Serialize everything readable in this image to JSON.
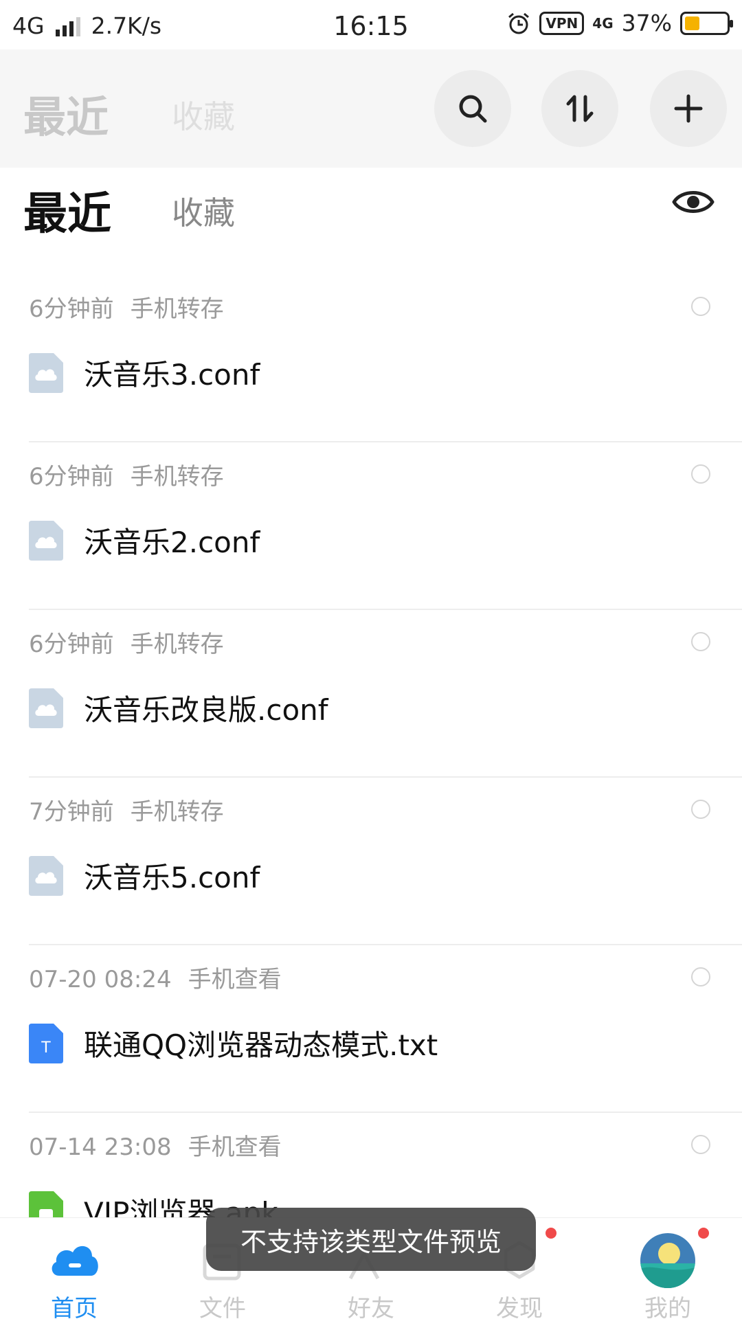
{
  "status_bar": {
    "network": "4G",
    "speed": "2.7K/s",
    "time": "16:15",
    "vpn": "VPN",
    "network2": "4G",
    "battery": "37%",
    "battery_level": 0.37
  },
  "sticky_header": {
    "tab_recent": "最近",
    "tab_favorites": "收藏",
    "search_icon": "search-icon",
    "sort_icon": "sort-icon",
    "add_icon": "plus-icon"
  },
  "tabs": {
    "recent": "最近",
    "favorites": "收藏",
    "eye_icon": "eye-icon"
  },
  "files": [
    {
      "time": "6分钟前",
      "source": "手机转存",
      "name": "沃音乐3.conf",
      "icon": "cloud-file-icon"
    },
    {
      "time": "6分钟前",
      "source": "手机转存",
      "name": "沃音乐2.conf",
      "icon": "cloud-file-icon"
    },
    {
      "time": "6分钟前",
      "source": "手机转存",
      "name": "沃音乐改良版.conf",
      "icon": "cloud-file-icon"
    },
    {
      "time": "7分钟前",
      "source": "手机转存",
      "name": "沃音乐5.conf",
      "icon": "cloud-file-icon"
    },
    {
      "time": "07-20 08:24",
      "source": "手机查看",
      "name": "联通QQ浏览器动态模式.txt",
      "icon": "txt-file-icon"
    },
    {
      "time": "07-14 23:08",
      "source": "手机查看",
      "name": "VIP浏览器.apk",
      "icon": "apk-file-icon"
    }
  ],
  "bottom_nav": [
    {
      "label": "首页",
      "icon": "cloud-home-icon",
      "active": true
    },
    {
      "label": "文件",
      "icon": "folder-icon",
      "active": false
    },
    {
      "label": "好友",
      "icon": "friends-icon",
      "active": false
    },
    {
      "label": "发现",
      "icon": "discover-icon",
      "active": false,
      "badge": true
    },
    {
      "label": "我的",
      "icon": "avatar",
      "active": false,
      "badge": true
    }
  ],
  "toast": "不支持该类型文件预览",
  "colors": {
    "accent": "#1f8ef1",
    "txt_icon": "#3a86f7",
    "apk_icon": "#5cc23a",
    "cloud_file_icon": "#c9d6e3",
    "badge": "#f04a4a"
  }
}
